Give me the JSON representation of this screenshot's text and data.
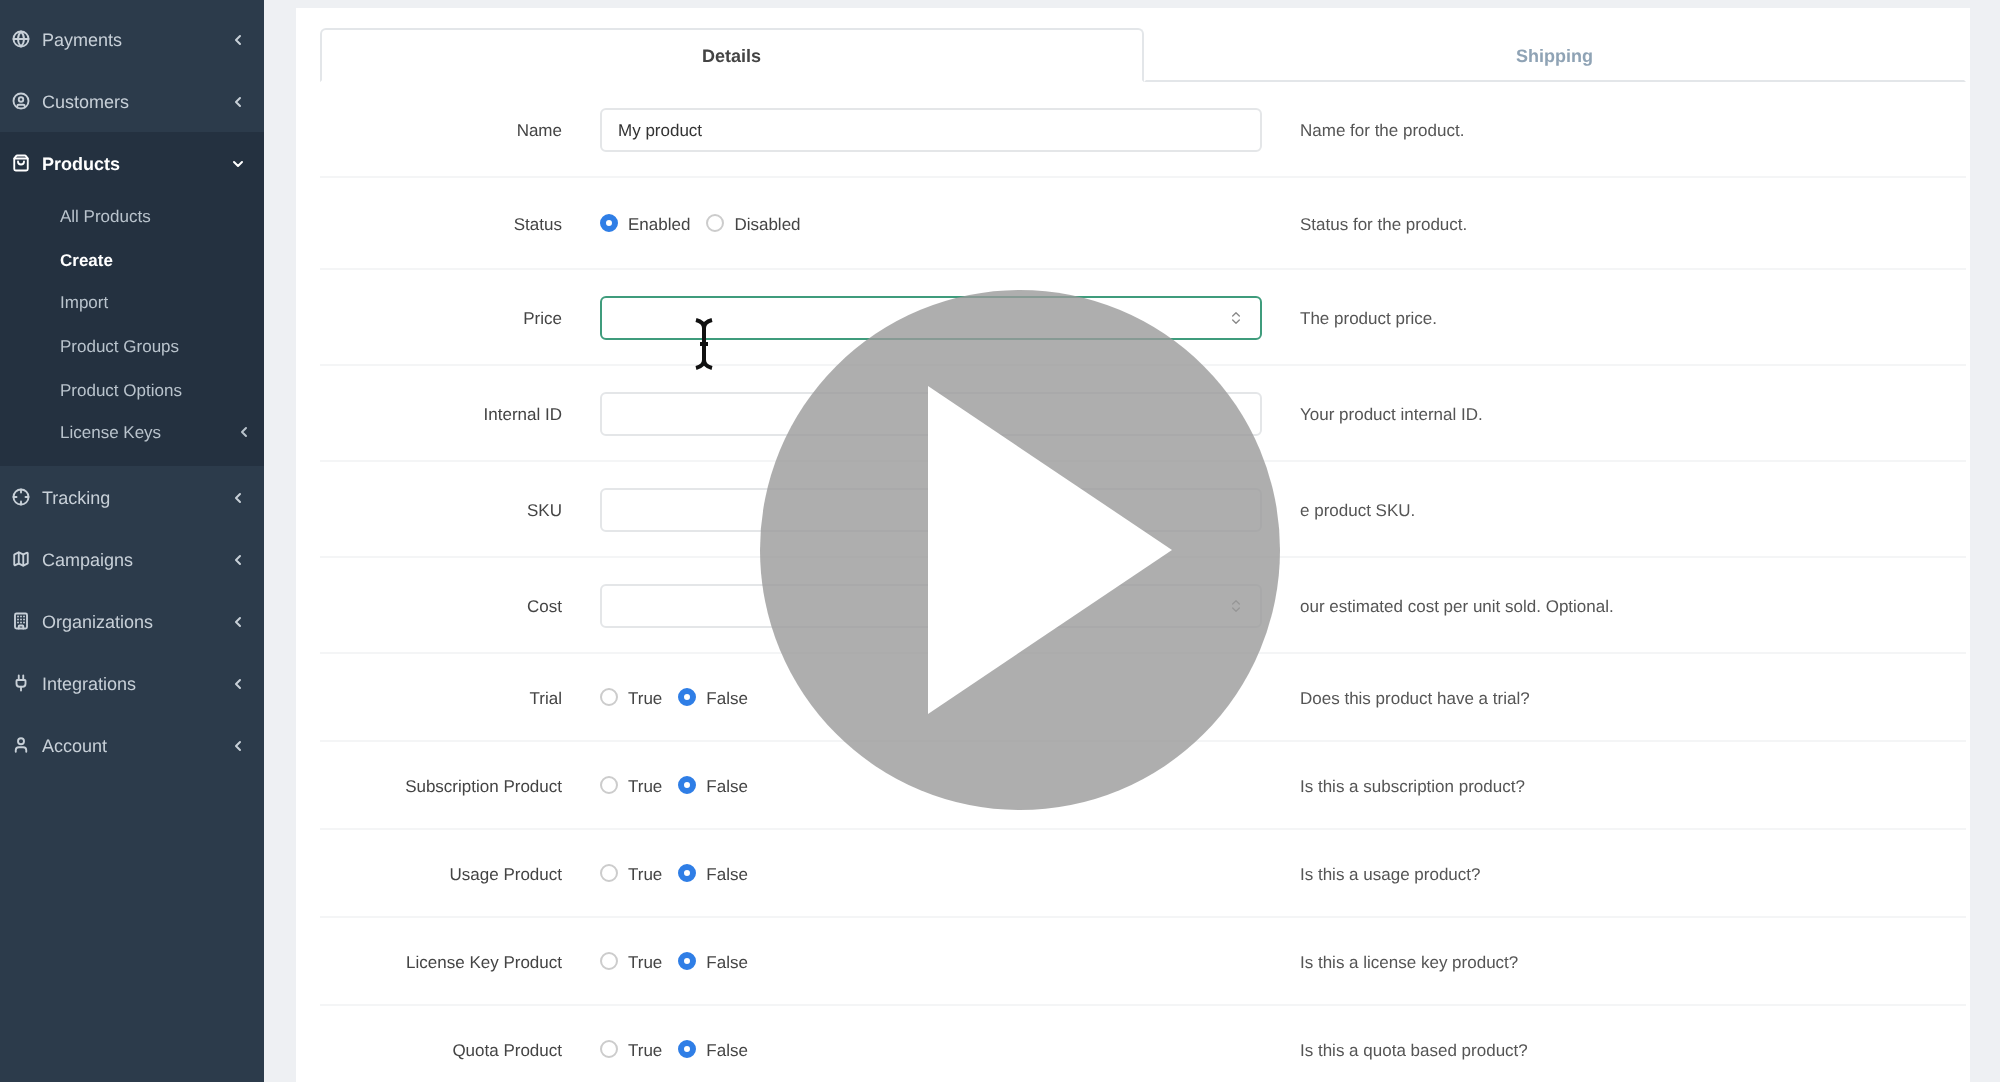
{
  "sidebar": {
    "items": [
      {
        "label": "Payments",
        "expanded": false
      },
      {
        "label": "Customers",
        "expanded": false
      },
      {
        "label": "Products",
        "expanded": true,
        "children": [
          {
            "label": "All Products",
            "selected": false
          },
          {
            "label": "Create",
            "selected": true
          },
          {
            "label": "Import",
            "selected": false
          },
          {
            "label": "Product Groups",
            "selected": false
          },
          {
            "label": "Product Options",
            "selected": false
          },
          {
            "label": "License Keys",
            "selected": false,
            "expanded": false
          }
        ]
      },
      {
        "label": "Tracking",
        "expanded": false
      },
      {
        "label": "Campaigns",
        "expanded": false
      },
      {
        "label": "Organizations",
        "expanded": false
      },
      {
        "label": "Integrations",
        "expanded": false
      },
      {
        "label": "Account",
        "expanded": false
      }
    ]
  },
  "tabs": [
    {
      "label": "Details",
      "selected": true
    },
    {
      "label": "Shipping",
      "selected": false
    }
  ],
  "fields": [
    {
      "label": "Name",
      "kind": "text",
      "value": "My product",
      "focused": false,
      "help": "Name for the product."
    },
    {
      "label": "Status",
      "kind": "radio",
      "options": [
        {
          "label": "Enabled",
          "selected": true
        },
        {
          "label": "Disabled",
          "selected": false
        }
      ],
      "help": "Status for the product."
    },
    {
      "label": "Price",
      "kind": "number",
      "focused": true,
      "help": "The product price."
    },
    {
      "label": "Internal ID",
      "kind": "text",
      "focused": false,
      "help": "Your product internal ID."
    },
    {
      "label": "SKU",
      "kind": "text",
      "focused": false,
      "help": "e product SKU."
    },
    {
      "label": "Cost",
      "kind": "number",
      "focused": false,
      "help": "our estimated cost per unit sold. Optional."
    },
    {
      "label": "Trial",
      "kind": "radio",
      "options": [
        {
          "label": "True",
          "selected": false
        },
        {
          "label": "False",
          "selected": true
        }
      ],
      "help": "Does this product have a trial?"
    },
    {
      "label": "Subscription Product",
      "kind": "radio",
      "options": [
        {
          "label": "True",
          "selected": false
        },
        {
          "label": "False",
          "selected": true
        }
      ],
      "help": "Is this a subscription product?"
    },
    {
      "label": "Usage Product",
      "kind": "radio",
      "options": [
        {
          "label": "True",
          "selected": false
        },
        {
          "label": "False",
          "selected": true
        }
      ],
      "help": "Is this a usage product?"
    },
    {
      "label": "License Key Product",
      "kind": "radio",
      "options": [
        {
          "label": "True",
          "selected": false
        },
        {
          "label": "False",
          "selected": true
        }
      ],
      "help": "Is this a license key product?"
    },
    {
      "label": "Quota Product",
      "kind": "radio",
      "options": [
        {
          "label": "True",
          "selected": false
        },
        {
          "label": "False",
          "selected": true
        }
      ],
      "help": "Is this a quota based product?"
    }
  ]
}
